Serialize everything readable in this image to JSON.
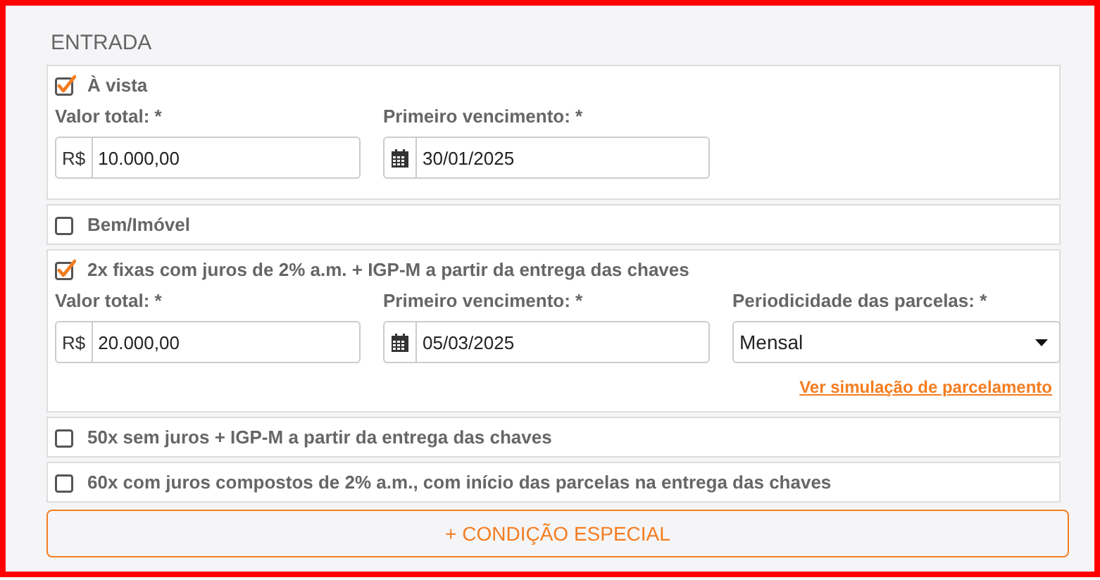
{
  "section_title": "ENTRADA",
  "options": [
    {
      "label": "À vista",
      "checked": true,
      "fields": [
        {
          "kind": "money",
          "label": "Valor total: *",
          "prefix": "R$",
          "value": "10.000,00"
        },
        {
          "kind": "date",
          "label": "Primeiro vencimento: *",
          "value": "30/01/2025"
        }
      ]
    },
    {
      "label": "Bem/Imóvel",
      "checked": false
    },
    {
      "label": "2x fixas com juros de 2% a.m. + IGP-M a partir da entrega das chaves",
      "checked": true,
      "fields": [
        {
          "kind": "money",
          "label": "Valor total: *",
          "prefix": "R$",
          "value": "20.000,00"
        },
        {
          "kind": "date",
          "label": "Primeiro vencimento: *",
          "value": "05/03/2025"
        },
        {
          "kind": "select",
          "label": "Periodicidade das parcelas: *",
          "value": "Mensal"
        }
      ],
      "link": "Ver simulação de parcelamento"
    },
    {
      "label": "50x sem juros + IGP-M a partir da entrega das chaves",
      "checked": false
    },
    {
      "label": "60x com juros compostos de 2% a.m., com início das parcelas na entrega das chaves",
      "checked": false
    }
  ],
  "add_button": "+ CONDIÇÃO ESPECIAL"
}
